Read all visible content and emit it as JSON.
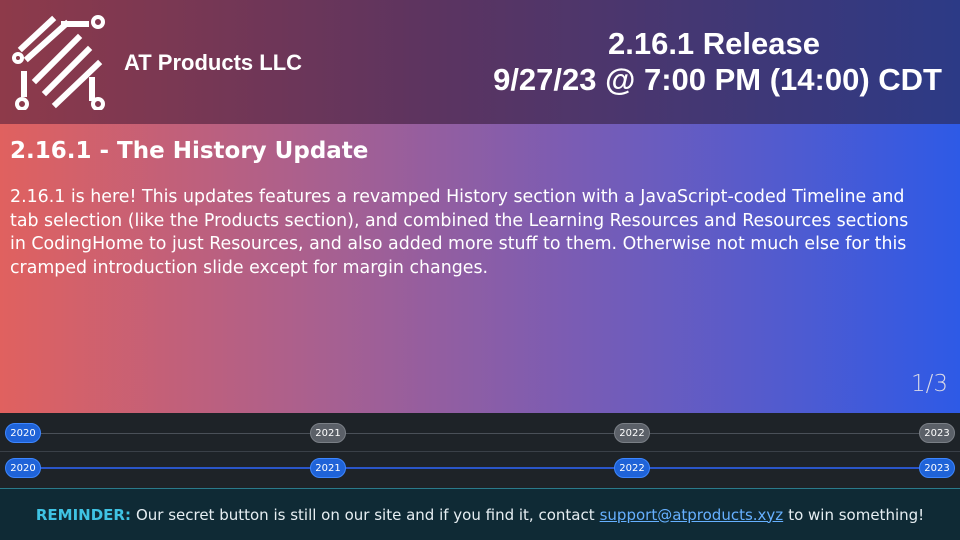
{
  "header": {
    "company": "AT Products LLC",
    "release_title": "2.16.1 Release",
    "release_date": "9/27/23 @ 7:00 PM (14:00) CDT"
  },
  "slide": {
    "title": "2.16.1 - The History Update",
    "body": "2.16.1 is here! This updates features a revamped History section with a JavaScript-coded Timeline and tab selection (like the Products section), and combined the Learning Resources and Resources sections in CodingHome to just Resources, and also added more stuff to them. Otherwise not much else for this cramped introduction slide except for margin changes.",
    "counter": "1/3"
  },
  "timeline": {
    "row1": [
      "2020",
      "2021",
      "2022",
      "2023"
    ],
    "row2": [
      "2020",
      "2021",
      "2022",
      "2023"
    ]
  },
  "footer": {
    "label": "REMINDER:",
    "text_before": "Our secret button is still on our site and if you find it, contact",
    "link": "support@atproducts.xyz",
    "text_after": "to win something!"
  },
  "colors": {
    "pill_active": "#1f63d8",
    "pill_inactive": "#5b6068",
    "reminder_label": "#3fc3e3",
    "link": "#66b0ff"
  }
}
